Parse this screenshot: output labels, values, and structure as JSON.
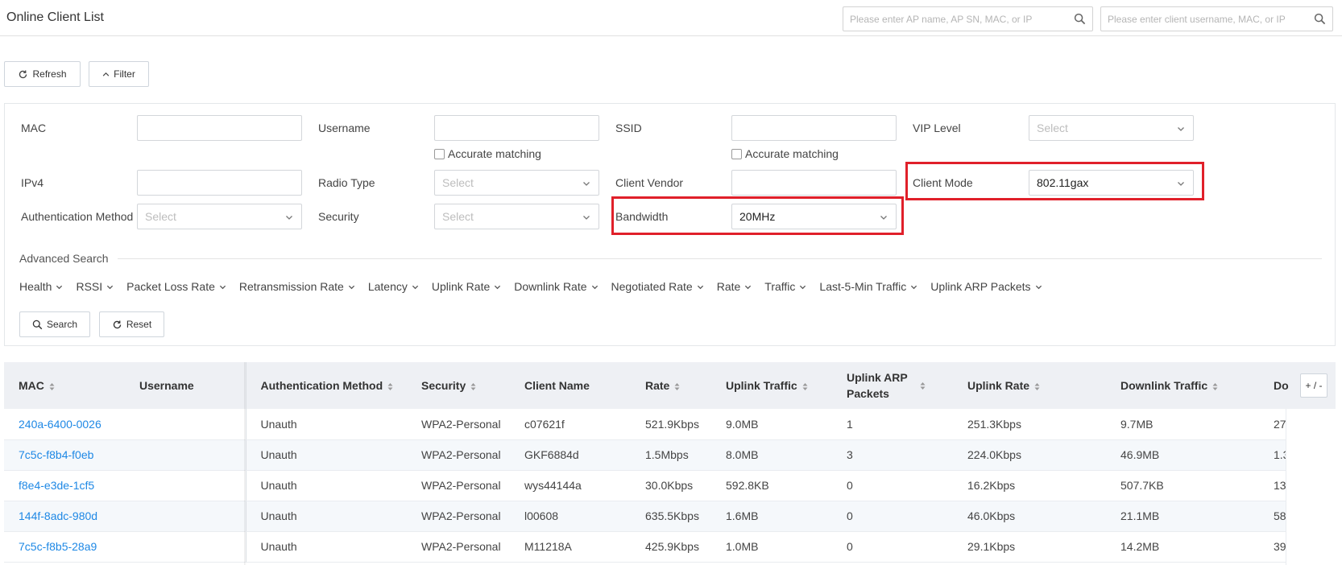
{
  "header": {
    "title": "Online Client List",
    "ap_search_placeholder": "Please enter AP name, AP SN, MAC, or IP",
    "client_search_placeholder": "Please enter client username, MAC, or IP"
  },
  "toolbar": {
    "refresh_label": "Refresh",
    "filter_label": "Filter"
  },
  "filters": {
    "mac_label": "MAC",
    "username_label": "Username",
    "ssid_label": "SSID",
    "vip_level_label": "VIP Level",
    "vip_level_placeholder": "Select",
    "accurate_matching_label": "Accurate matching",
    "ipv4_label": "IPv4",
    "radio_type_label": "Radio Type",
    "radio_type_placeholder": "Select",
    "client_vendor_label": "Client Vendor",
    "client_mode_label": "Client Mode",
    "client_mode_value": "802.11gax",
    "auth_method_label": "Authentication Method",
    "auth_method_placeholder": "Select",
    "security_label": "Security",
    "security_placeholder": "Select",
    "bandwidth_label": "Bandwidth",
    "bandwidth_value": "20MHz"
  },
  "advanced": {
    "title": "Advanced Search",
    "items": [
      "Health",
      "RSSI",
      "Packet Loss Rate",
      "Retransmission Rate",
      "Latency",
      "Uplink Rate",
      "Downlink Rate",
      "Negotiated Rate",
      "Rate",
      "Traffic",
      "Last-5-Min Traffic",
      "Uplink ARP Packets"
    ],
    "search_label": "Search",
    "reset_label": "Reset"
  },
  "table": {
    "columns": [
      "MAC",
      "Username",
      "Authentication Method",
      "Security",
      "Client Name",
      "Rate",
      "Uplink Traffic",
      "Uplink ARP Packets",
      "Uplink Rate",
      "Downlink Traffic",
      "Do"
    ],
    "rows": [
      [
        "240a-6400-0026",
        "",
        "Unauth",
        "WPA2-Personal",
        "c07621f",
        "521.9Kbps",
        "9.0MB",
        "1",
        "251.3Kbps",
        "9.7MB",
        "27"
      ],
      [
        "7c5c-f8b4-f0eb",
        "",
        "Unauth",
        "WPA2-Personal",
        "GKF6884d",
        "1.5Mbps",
        "8.0MB",
        "3",
        "224.0Kbps",
        "46.9MB",
        "1.3"
      ],
      [
        "f8e4-e3de-1cf5",
        "",
        "Unauth",
        "WPA2-Personal",
        "wys44144a",
        "30.0Kbps",
        "592.8KB",
        "0",
        "16.2Kbps",
        "507.7KB",
        "13"
      ],
      [
        "144f-8adc-980d",
        "",
        "Unauth",
        "WPA2-Personal",
        "l00608",
        "635.5Kbps",
        "1.6MB",
        "0",
        "46.0Kbps",
        "21.1MB",
        "58"
      ],
      [
        "7c5c-f8b5-28a9",
        "",
        "Unauth",
        "WPA2-Personal",
        "M11218A",
        "425.9Kbps",
        "1.0MB",
        "0",
        "29.1Kbps",
        "14.2MB",
        "39"
      ]
    ],
    "col_toggle_label": "+ / -"
  },
  "colors": {
    "accent_link": "#1e88e5",
    "highlight": "#e0202a",
    "header_bg": "#eef0f4"
  }
}
